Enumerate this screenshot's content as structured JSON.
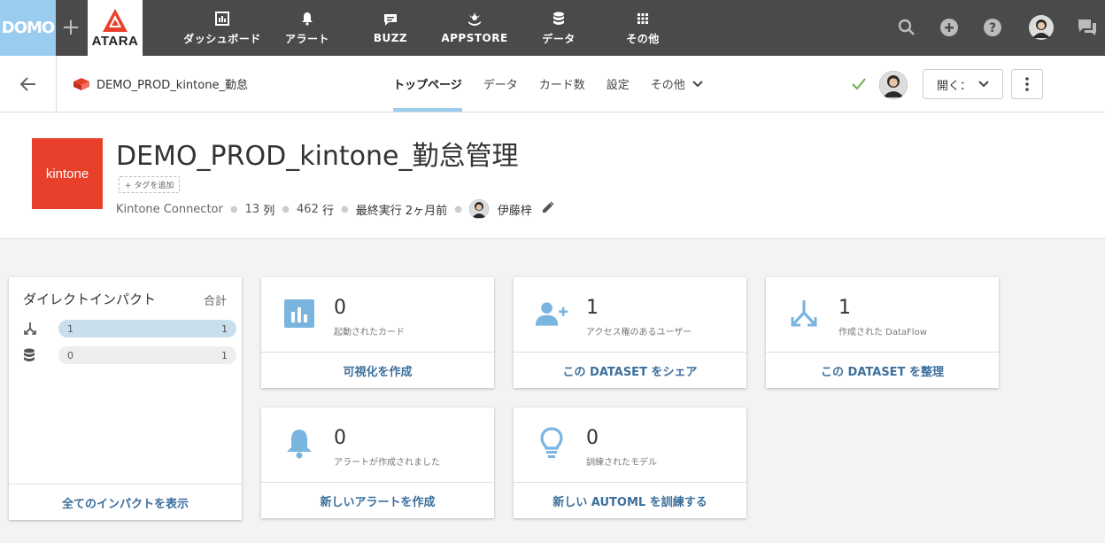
{
  "topnav": {
    "domo_logo": "DOMO",
    "plus": "+",
    "atara_logo": "ATARA",
    "items": [
      {
        "label": "ダッシュボード"
      },
      {
        "label": "アラート"
      },
      {
        "label": "BUZZ"
      },
      {
        "label": "APPSTORE"
      },
      {
        "label": "データ"
      },
      {
        "label": "その他"
      }
    ]
  },
  "subheader": {
    "dataset_name": "DEMO_PROD_kintone_勤怠",
    "tabs": [
      {
        "label": "トップページ"
      },
      {
        "label": "データ"
      },
      {
        "label": "カード数"
      },
      {
        "label": "設定"
      },
      {
        "label": "その他"
      }
    ],
    "open_label": "開く："
  },
  "dataset": {
    "logo_text": "kintone",
    "title": "DEMO_PROD_kintone_勤怠管理",
    "add_tag": "+ タグを追加",
    "connector": "Kintone Connector",
    "columns_num": "13",
    "columns_unit": "列",
    "rows_num": "462",
    "rows_unit": "行",
    "last_run_label": "最終実行",
    "last_run_value": "2ヶ月前",
    "owner": "伊藤梓"
  },
  "impact": {
    "title": "ダイレクトインパクト",
    "total_label": "合計",
    "rows": [
      {
        "value": "1",
        "total": "1",
        "icon": "dataflow-icon"
      },
      {
        "value": "0",
        "total": "1",
        "icon": "database-icon"
      }
    ],
    "footer": "全てのインパクトを表示"
  },
  "cards": [
    {
      "number": "0",
      "label": "起動されたカード",
      "action": "可視化を作成",
      "icon": "bar-chart-icon"
    },
    {
      "number": "1",
      "label": "アクセス権のあるユーザー",
      "action": "この DATASET をシェア",
      "icon": "add-user-icon"
    },
    {
      "number": "1",
      "label": "作成された DataFlow",
      "action": "この DATASET を整理",
      "icon": "dataflow-icon"
    },
    {
      "number": "0",
      "label": "アラートが作成されました",
      "action": "新しいアラートを作成",
      "icon": "bell-icon"
    },
    {
      "number": "0",
      "label": "訓練されたモデル",
      "action": "新しい AUTOML を訓練する",
      "icon": "lightbulb-icon"
    }
  ],
  "colors": {
    "topnav_bg": "#4a4a4a",
    "domo_blue": "#99ccee",
    "kintone_red": "#e8402b",
    "link_blue": "#3c6f9c",
    "icon_blue": "#7ab5e0"
  }
}
